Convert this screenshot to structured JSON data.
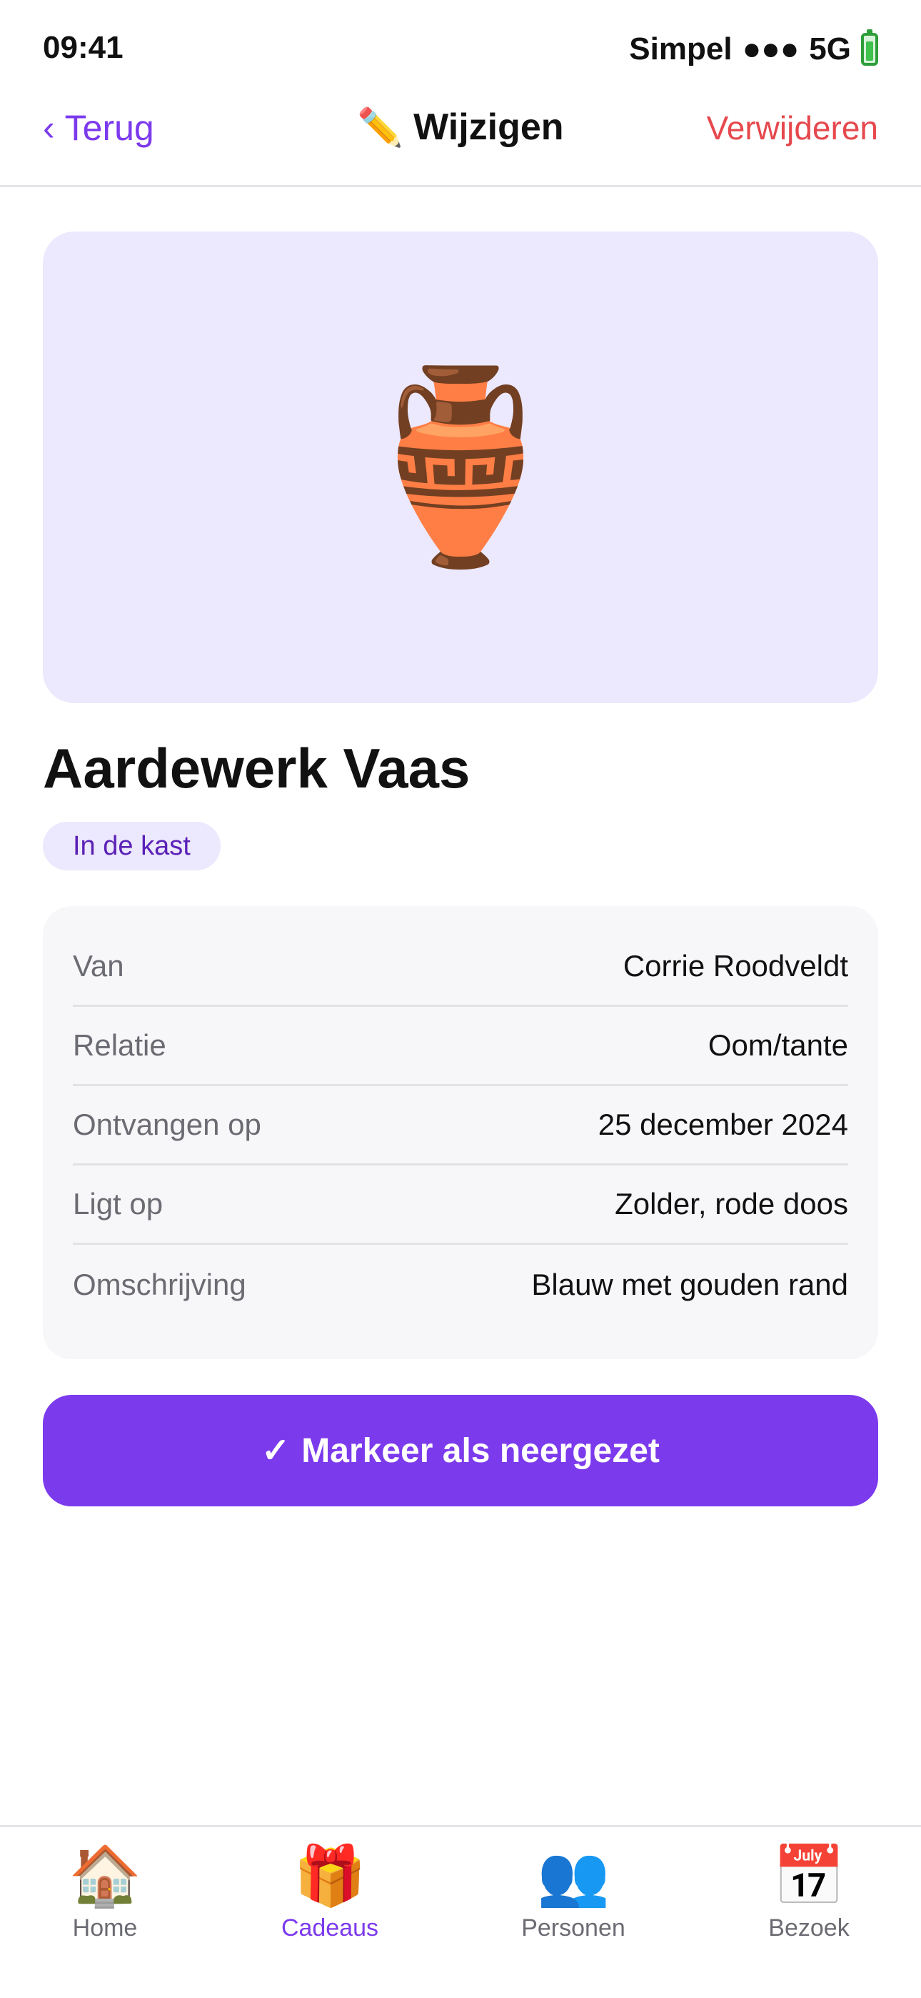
{
  "status_bar": {
    "time": "09:41",
    "carrier": "Simpel",
    "signal": "●●●",
    "network": "5G"
  },
  "nav": {
    "back_chevron": "‹",
    "back_label": "Terug",
    "title_emoji": "✏️",
    "title": "Wijzigen",
    "delete_label": "Verwijderen"
  },
  "gift": {
    "image_emoji": "🏺",
    "title": "Aardewerk Vaas",
    "status": "In de kast"
  },
  "details": [
    {
      "label": "Van",
      "value": "Corrie Roodveldt"
    },
    {
      "label": "Relatie",
      "value": "Oom/tante"
    },
    {
      "label": "Ontvangen op",
      "value": "25 december 2024"
    },
    {
      "label": "Ligt op",
      "value": "Zolder, rode doos"
    },
    {
      "label": "Omschrijving",
      "value": "Blauw met gouden rand"
    }
  ],
  "action": {
    "check": "✓",
    "label": "Markeer als neergezet"
  },
  "tabs": [
    {
      "icon": "🏠",
      "icon_name": "home-icon",
      "label": "Home",
      "active": false
    },
    {
      "icon": "🎁",
      "icon_name": "gift-icon",
      "label": "Cadeaus",
      "active": true
    },
    {
      "icon": "👥",
      "icon_name": "people-icon",
      "label": "Personen",
      "active": false
    },
    {
      "icon": "📅",
      "icon_name": "calendar-icon",
      "label": "Bezoek",
      "active": false
    }
  ],
  "colors": {
    "accent": "#7c3aed",
    "danger": "#e5484d",
    "badge_bg": "#ece8fd",
    "card_bg": "#f7f7f9"
  }
}
